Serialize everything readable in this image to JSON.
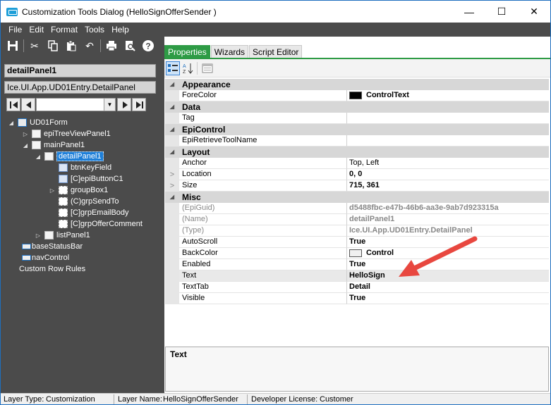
{
  "window": {
    "title": "Customization Tools Dialog  (HelloSignOfferSender )",
    "min": "—",
    "max": "☐",
    "close": "✕"
  },
  "menu": [
    "File",
    "Edit",
    "Format",
    "Tools",
    "Help"
  ],
  "left": {
    "selected_name": "detailPanel1",
    "selected_type": "Ice.UI.App.UD01Entry.DetailPanel",
    "tree": [
      {
        "label": "UD01Form",
        "level": 0,
        "exp": "◢",
        "icon": "form"
      },
      {
        "label": "epiTreeViewPanel1",
        "level": 1,
        "exp": "▷",
        "icon": "panel"
      },
      {
        "label": "mainPanel1",
        "level": 1,
        "exp": "◢",
        "icon": "panel"
      },
      {
        "label": "detailPanel1",
        "level": 2,
        "exp": "◢",
        "icon": "panel",
        "selected": true
      },
      {
        "label": "btnKeyField",
        "level": 3,
        "exp": "",
        "icon": "btn"
      },
      {
        "label": "[C]epiButtonC1",
        "level": 3,
        "exp": "",
        "icon": "btn"
      },
      {
        "label": "groupBox1",
        "level": 3,
        "exp": "▷",
        "icon": "group"
      },
      {
        "label": "(C)grpSendTo",
        "level": 3,
        "exp": "",
        "icon": "group"
      },
      {
        "label": "[C]grpEmailBody",
        "level": 3,
        "exp": "",
        "icon": "group"
      },
      {
        "label": "[C]grpOfferComment",
        "level": 3,
        "exp": "",
        "icon": "group"
      },
      {
        "label": "listPanel1",
        "level": 2,
        "exp": "▷",
        "icon": "panel"
      },
      {
        "label": "baseStatusBar",
        "level": 1,
        "exp": "",
        "icon": "bar"
      },
      {
        "label": "navControl",
        "level": 1,
        "exp": "",
        "icon": "bar"
      },
      {
        "label": "Custom Row Rules",
        "level": 0,
        "exp": "",
        "icon": ""
      }
    ]
  },
  "tabs": [
    "Properties",
    "Wizards",
    "Script Editor"
  ],
  "grid": [
    {
      "type": "cat",
      "label": "Appearance"
    },
    {
      "type": "prop",
      "name": "ForeColor",
      "value": "ControlText",
      "swatch": "#000000"
    },
    {
      "type": "cat",
      "label": "Data"
    },
    {
      "type": "prop",
      "name": "Tag",
      "value": ""
    },
    {
      "type": "cat",
      "label": "EpiControl"
    },
    {
      "type": "prop",
      "name": "EpiRetrieveToolName",
      "value": ""
    },
    {
      "type": "cat",
      "label": "Layout"
    },
    {
      "type": "prop",
      "name": "Anchor",
      "value": "Top, Left",
      "plain": true
    },
    {
      "type": "prop",
      "name": "Location",
      "value": "0, 0",
      "gutter": ">"
    },
    {
      "type": "prop",
      "name": "Size",
      "value": "715, 361",
      "gutter": ">"
    },
    {
      "type": "cat",
      "label": "Misc"
    },
    {
      "type": "prop",
      "name": "(EpiGuid)",
      "value": "d5488fbc-e47b-46b6-aa3e-9ab7d923315a",
      "ro": true
    },
    {
      "type": "prop",
      "name": "(Name)",
      "value": "detailPanel1",
      "ro": true
    },
    {
      "type": "prop",
      "name": "(Type)",
      "value": "Ice.UI.App.UD01Entry.DetailPanel",
      "ro": true
    },
    {
      "type": "prop",
      "name": "AutoScroll",
      "value": "True"
    },
    {
      "type": "prop",
      "name": "BackColor",
      "value": "Control",
      "swatch": "#f0f0f0"
    },
    {
      "type": "prop",
      "name": "Enabled",
      "value": "True"
    },
    {
      "type": "prop",
      "name": "Text",
      "value": "HelloSign",
      "hl": true
    },
    {
      "type": "prop",
      "name": "TextTab",
      "value": "Detail"
    },
    {
      "type": "prop",
      "name": "Visible",
      "value": "True"
    }
  ],
  "description": {
    "title": "Text"
  },
  "status": {
    "layer_type_label": "Layer Type:",
    "layer_type": "Customization",
    "layer_name_label": "Layer Name:",
    "layer_name": "HelloSignOfferSender",
    "license_label": "Developer License:",
    "license": "Customer"
  },
  "colors": {
    "accent": "#2e9b45",
    "selection": "#1e7fd8",
    "arrow": "#e8473f",
    "dark": "#4b4b4b"
  }
}
